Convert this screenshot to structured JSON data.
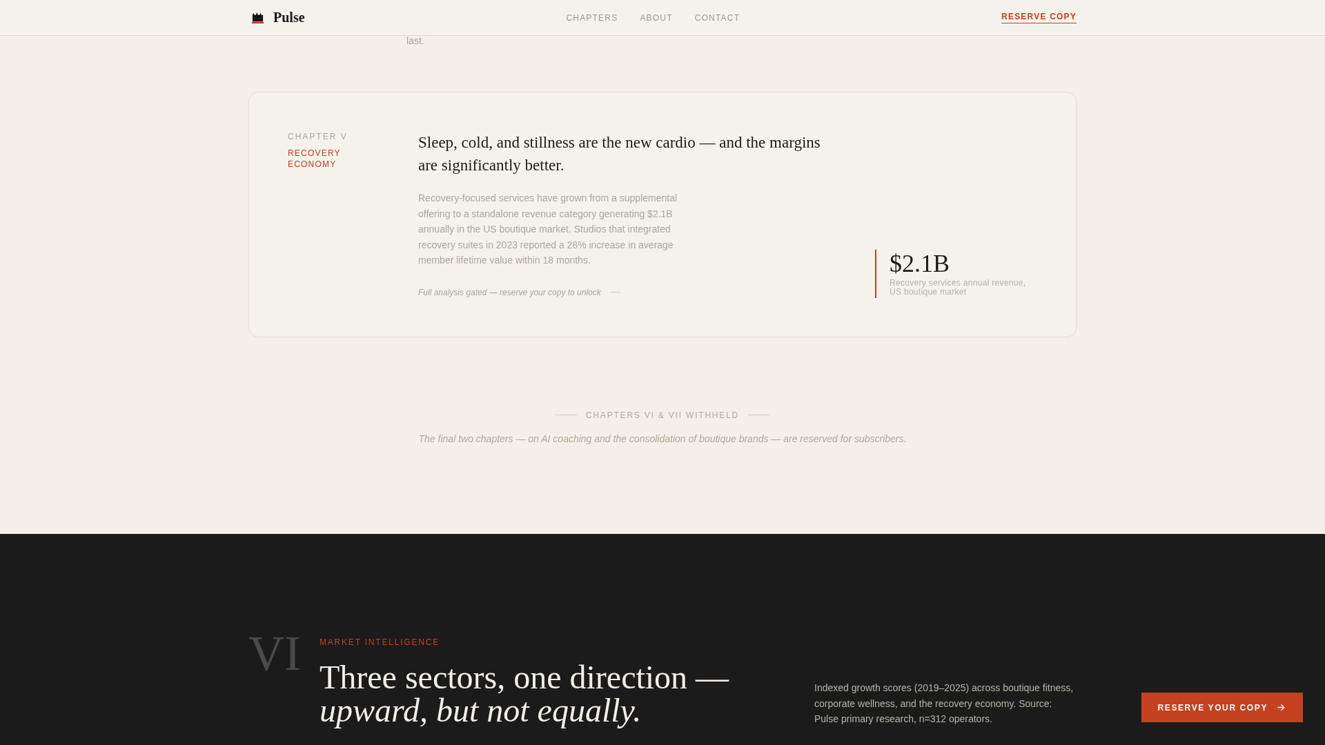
{
  "header": {
    "logo": "Pulse",
    "nav": [
      "CHAPTERS",
      "ABOUT",
      "CONTACT"
    ],
    "cta": "RESERVE COPY"
  },
  "previous_text": "last.",
  "chapter": {
    "number": "CHAPTER V",
    "name": "RECOVERY ECONOMY",
    "headline": "Sleep, cold, and stillness are the new cardio — and the margins are significantly better.",
    "body": "Recovery-focused services have grown from a supplemental offering to a standalone revenue category generating $2.1B annually in the US boutique market. Studios that integrated recovery suites in 2023 reported a 28% increase in average member lifetime value within 18 months.",
    "gated_note": "Full analysis gated — reserve your copy to unlock",
    "stat": {
      "value": "$2.1B",
      "caption": "Recovery services annual revenue, US boutique market"
    }
  },
  "withheld": {
    "label": "CHAPTERS VI & VII WITHHELD",
    "note": "The final two chapters — on AI coaching and the consolidation of boutique brands — are reserved for subscribers."
  },
  "market_section": {
    "numeral": "VI",
    "eyebrow": "MARKET INTELLIGENCE",
    "headline": "Three sectors, one direction — *upward, but not equally.*",
    "description": "Indexed growth scores (2019–2025) across boutique fitness, corporate wellness, and the recovery economy. Source: Pulse primary research, n=312 operators."
  },
  "floating_button": {
    "label": "RESERVE YOUR COPY"
  }
}
